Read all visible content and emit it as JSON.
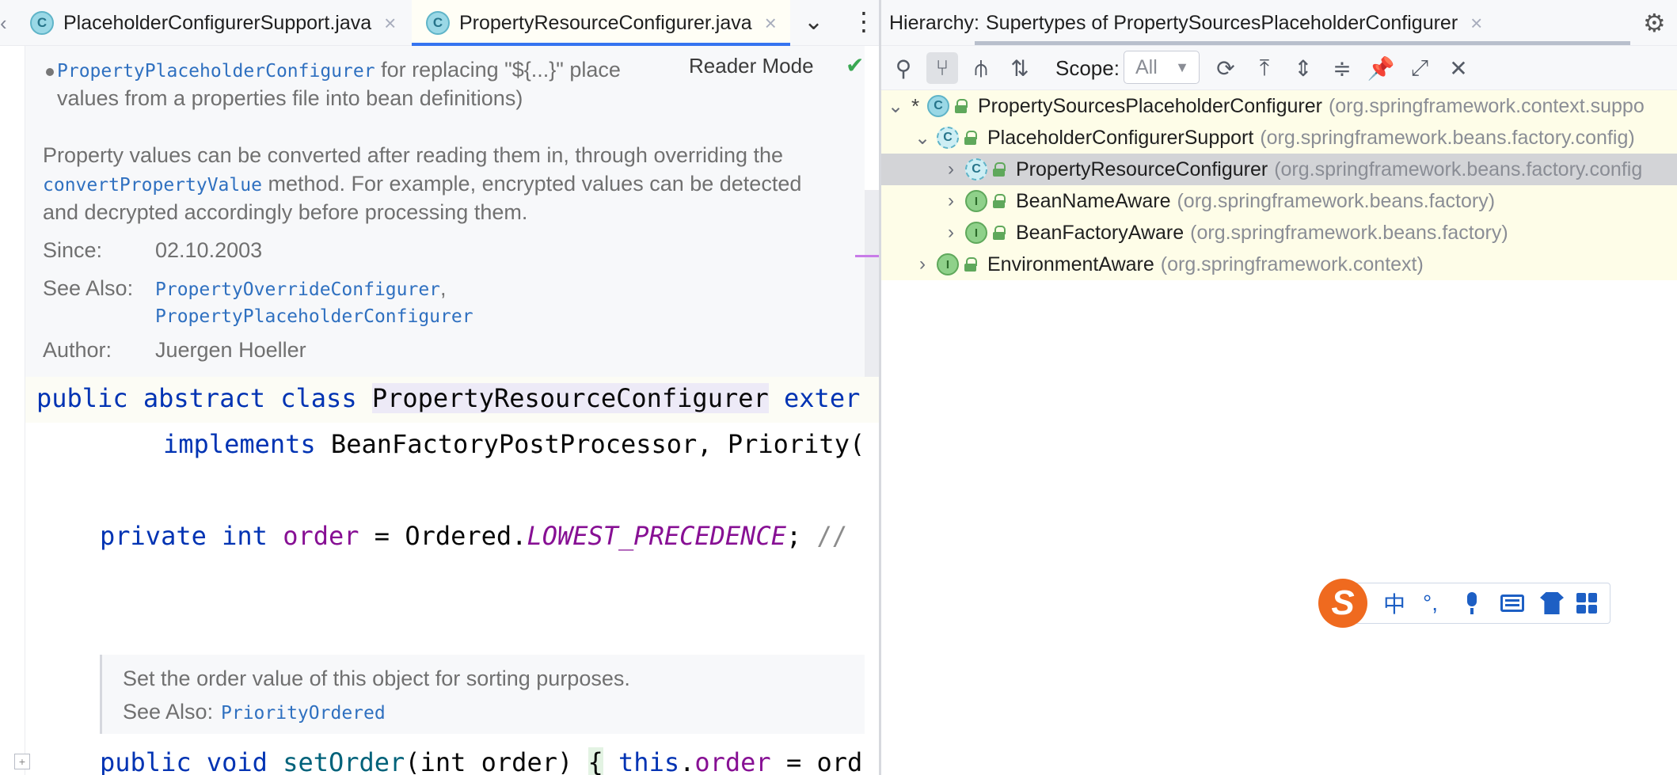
{
  "editor": {
    "tabs": [
      {
        "label": "PlaceholderConfigurerSupport.java",
        "icon": "class-icon",
        "icon_letter": "C"
      },
      {
        "label": "PropertyResourceConfigurer.java",
        "icon": "class-icon",
        "icon_letter": "C"
      }
    ],
    "close_glyph": "×",
    "doc": {
      "bullet_link": "PropertyPlaceholderConfigurer",
      "bullet_text_1": " for replacing \"${...}\" place",
      "bullet_text_2": "values from a properties file into bean definitions)",
      "reader_mode": "Reader Mode",
      "para_line1": "Property values can be converted after reading them in, through overriding the",
      "para_line2_link": "convertPropertyValue",
      "para_line2_text": " method. For example, encrypted values can be detected",
      "para_line3": "and decrypted accordingly before processing them.",
      "since_label": "Since:",
      "since_value": "02.10.2003",
      "see_also_label": "See Also:",
      "see_also_1": "PropertyOverrideConfigurer",
      "see_also_sep": ",",
      "see_also_2": "PropertyPlaceholderConfigurer",
      "author_label": "Author:",
      "author_value": "Juergen Hoeller"
    },
    "code": {
      "l1_kw": "public abstract class ",
      "l1_class": "PropertyResourceConfigurer",
      "l1_rest": " exter",
      "l2_kw": "implements ",
      "l2_rest": "BeanFactoryPostProcessor, Priority(",
      "l3_kw": "private int ",
      "l3_field": "order",
      "l3_mid": " = Ordered.",
      "l3_const": "LOWEST_PRECEDENCE",
      "l3_end": ";  ",
      "l3_cmt": "//",
      "l4_kw": "public void ",
      "l4_fn": "setOrder",
      "l4_params": "(int order) ",
      "l4_brace": "{",
      "l4_this": " this",
      "l4_dot": ".",
      "l4_field": "order",
      "l4_end": " = ord"
    },
    "doc2": {
      "line1": "Set the order value of this object for sorting purposes.",
      "see_also_label": "See Also:",
      "see_also_link": "PriorityOrdered"
    }
  },
  "hierarchy": {
    "label": "Hierarchy:",
    "tab_title": "Supertypes of PropertySourcesPlaceholderConfigurer",
    "scope_label": "Scope:",
    "scope_value": "All",
    "tree": [
      {
        "expanded": true,
        "star": "*",
        "kind": "class",
        "name": "PropertySourcesPlaceholderConfigurer",
        "pkg": "(org.springframework.context.suppo"
      },
      {
        "expanded": true,
        "kind": "abstract-class",
        "name": "PlaceholderConfigurerSupport",
        "pkg": "(org.springframework.beans.factory.config)"
      },
      {
        "expanded": false,
        "kind": "abstract-class",
        "name": "PropertyResourceConfigurer",
        "pkg": "(org.springframework.beans.factory.config",
        "selected": true
      },
      {
        "expanded": false,
        "kind": "interface",
        "name": "BeanNameAware",
        "pkg": "(org.springframework.beans.factory)"
      },
      {
        "expanded": false,
        "kind": "interface",
        "name": "BeanFactoryAware",
        "pkg": "(org.springframework.beans.factory)"
      },
      {
        "expanded": false,
        "kind": "interface",
        "name": "EnvironmentAware",
        "pkg": "(org.springframework.context)"
      }
    ]
  },
  "ime": {
    "logo": "S",
    "lang": "中",
    "punct": "°,"
  },
  "colors": {
    "accent": "#3574f0",
    "keyword": "#0033b3",
    "field": "#871094",
    "tree_bg": "#fefde8",
    "ime_blue": "#1d5fc4",
    "ime_logo": "#ef6a1f"
  }
}
